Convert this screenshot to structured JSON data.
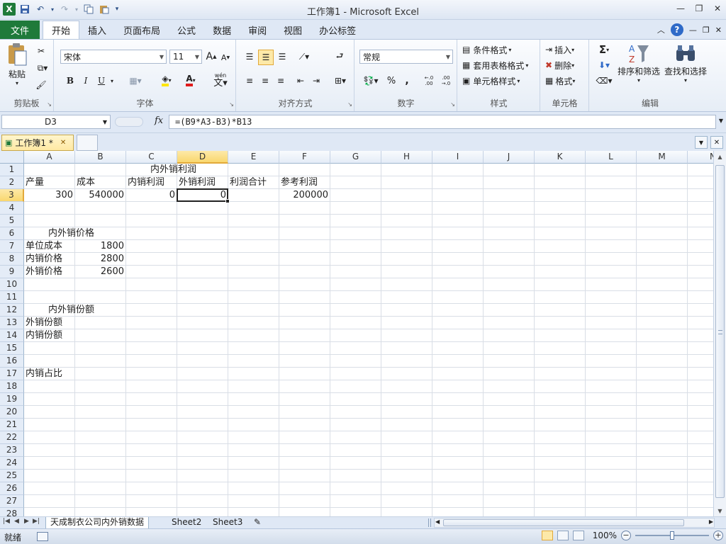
{
  "window": {
    "title": "工作簿1 - Microsoft Excel"
  },
  "ribbon_tabs": {
    "file": "文件",
    "tabs": [
      "开始",
      "插入",
      "页面布局",
      "公式",
      "数据",
      "审阅",
      "视图",
      "办公标签"
    ]
  },
  "clipboard": {
    "paste": "粘贴",
    "label": "剪贴板"
  },
  "font": {
    "family": "宋体",
    "size": "11",
    "label": "字体",
    "bold": "B",
    "italic": "I",
    "underline": "U",
    "phonetic": "wén"
  },
  "alignment": {
    "label": "对齐方式"
  },
  "number": {
    "format": "常规",
    "label": "数字",
    "percent": "%",
    "comma": ",",
    "inc_decimal": "←.0 .00",
    "dec_decimal": ".00 →.0"
  },
  "styles": {
    "conditional": "条件格式",
    "table": "套用表格格式",
    "cell": "单元格样式",
    "label": "样式"
  },
  "cells_group": {
    "insert": "插入",
    "delete": "删除",
    "format": "格式",
    "label": "单元格"
  },
  "editing": {
    "sort": "排序和筛选",
    "find": "查找和选择",
    "label": "编辑",
    "sum": "Σ"
  },
  "formula_bar": {
    "name_box": "D3",
    "fx": "fx",
    "formula": "=(B9*A3-B3)*B13"
  },
  "workbook_tab": {
    "name": "工作簿1 *"
  },
  "columns": [
    "A",
    "B",
    "C",
    "D",
    "E",
    "F",
    "G",
    "H",
    "I",
    "J",
    "K",
    "L",
    "M",
    "N"
  ],
  "rows": [
    "1",
    "2",
    "3",
    "4",
    "5",
    "6",
    "7",
    "8",
    "9",
    "10",
    "11",
    "12",
    "13",
    "14",
    "15",
    "16",
    "17",
    "18",
    "19",
    "20",
    "21",
    "22",
    "23",
    "24",
    "25",
    "26",
    "27",
    "28"
  ],
  "cells": {
    "title1": "内外销利润",
    "A2": "产量",
    "B2": "成本",
    "C2": "内销利润",
    "D2": "外销利润",
    "E2": "利润合计",
    "F2": "参考利润",
    "A3": "300",
    "B3": "540000",
    "C3": "0",
    "D3": "0",
    "F3": "200000",
    "title6": "内外销价格",
    "A7": "单位成本",
    "B7": "1800",
    "A8": "内销价格",
    "B8": "2800",
    "A9": "外销价格",
    "B9": "2600",
    "title12": "内外销份额",
    "A13": "外销份额",
    "A14": "内销份额",
    "A17": "内销占比"
  },
  "sheets": [
    "天成制衣公司内外销数据",
    "Sheet2",
    "Sheet3"
  ],
  "status": {
    "ready": "就绪",
    "zoom": "100%"
  },
  "colors": {
    "excel_green": "#1f7a3a",
    "selection_header": "#f9d76e"
  }
}
